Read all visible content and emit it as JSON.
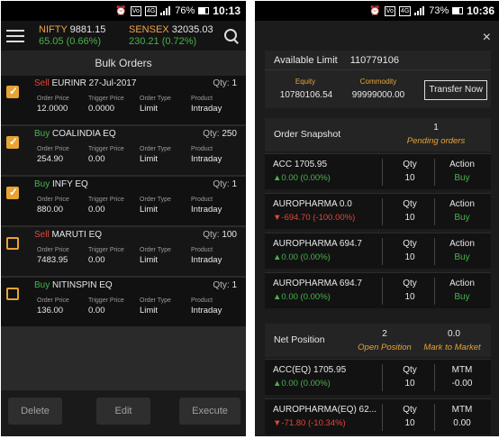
{
  "left": {
    "status": {
      "network": "4G",
      "battery": "76%",
      "time": "10:13"
    },
    "indices": [
      {
        "name": "NIFTY",
        "value": "9881.15",
        "change": "65.05 (0.66%)"
      },
      {
        "name": "SENSEX",
        "value": "32035.03",
        "change": "230.21 (0.72%)"
      }
    ],
    "title": "Bulk Orders",
    "col_headers": {
      "price": "Order Price",
      "trigger": "Trigger Price",
      "type": "Order Type",
      "product": "Product"
    },
    "qty_label": "Qty:",
    "orders": [
      {
        "side": "Sell",
        "instrument": "EURINR 27-Jul-2017",
        "qty": "1",
        "checked": true,
        "price": "12.0000",
        "trigger": "0.0000",
        "type": "Limit",
        "product": "Intraday"
      },
      {
        "side": "Buy",
        "instrument": "COALINDIA EQ",
        "qty": "250",
        "checked": true,
        "price": "254.90",
        "trigger": "0.00",
        "type": "Limit",
        "product": "Intraday"
      },
      {
        "side": "Buy",
        "instrument": "INFY EQ",
        "qty": "1",
        "checked": true,
        "price": "880.00",
        "trigger": "0.00",
        "type": "Limit",
        "product": "Intraday"
      },
      {
        "side": "Sell",
        "instrument": "MARUTI EQ",
        "qty": "100",
        "checked": false,
        "price": "7483.95",
        "trigger": "0.00",
        "type": "Limit",
        "product": "Intraday"
      },
      {
        "side": "Buy",
        "instrument": "NITINSPIN EQ",
        "qty": "1",
        "checked": false,
        "price": "136.00",
        "trigger": "0.00",
        "type": "Limit",
        "product": "Intraday"
      }
    ],
    "buttons": {
      "delete": "Delete",
      "edit": "Edit",
      "execute": "Execute"
    }
  },
  "right": {
    "status": {
      "network": "4G",
      "battery": "73%",
      "time": "10:36"
    },
    "close": "×",
    "available_limit": {
      "label": "Available Limit",
      "value": "110779106"
    },
    "equity": {
      "label": "Equity",
      "value": "10780106.54"
    },
    "commodity": {
      "label": "Commodity",
      "value": "99999000.00"
    },
    "transfer": "Transfer Now",
    "order_snapshot": {
      "label": "Order Snapshot",
      "count": "1",
      "sub": "Pending orders"
    },
    "snapshot_rows": [
      {
        "name": "ACC 1705.95",
        "change": "0.00 (0.00%)",
        "dir": "up",
        "qty_h": "Qty",
        "qty": "10",
        "act_h": "Action",
        "action": "Buy"
      },
      {
        "name": "AUROPHARMA 0.0",
        "change": "-694.70 (-100.00%)",
        "dir": "dn",
        "qty_h": "Qty",
        "qty": "10",
        "act_h": "Action",
        "action": "Buy"
      },
      {
        "name": "AUROPHARMA 694.7",
        "change": "0.00 (0.00%)",
        "dir": "up",
        "qty_h": "Qty",
        "qty": "10",
        "act_h": "Action",
        "action": "Buy"
      },
      {
        "name": "AUROPHARMA 694.7",
        "change": "0.00 (0.00%)",
        "dir": "up",
        "qty_h": "Qty",
        "qty": "10",
        "act_h": "Action",
        "action": "Buy"
      }
    ],
    "net_position": {
      "label": "Net Position",
      "count": "2",
      "sub": "Open Position",
      "mtm_val": "0.0",
      "mtm_sub": "Mark to Market"
    },
    "position_rows": [
      {
        "name": "ACC(EQ) 1705.95",
        "change": "0.00 (0.00%)",
        "dir": "up",
        "qty_h": "Qty",
        "qty": "10",
        "mtm_h": "MTM",
        "mtm": "-0.00"
      },
      {
        "name": "AUROPHARMA(EQ) 62...",
        "change": "-71.80 (-10.34%)",
        "dir": "dn",
        "qty_h": "Qty",
        "qty": "10",
        "mtm_h": "MTM",
        "mtm": "0.00"
      }
    ],
    "colors": {
      "accent": "#e7a335",
      "up": "#49b24d",
      "down": "#e2463a"
    }
  }
}
